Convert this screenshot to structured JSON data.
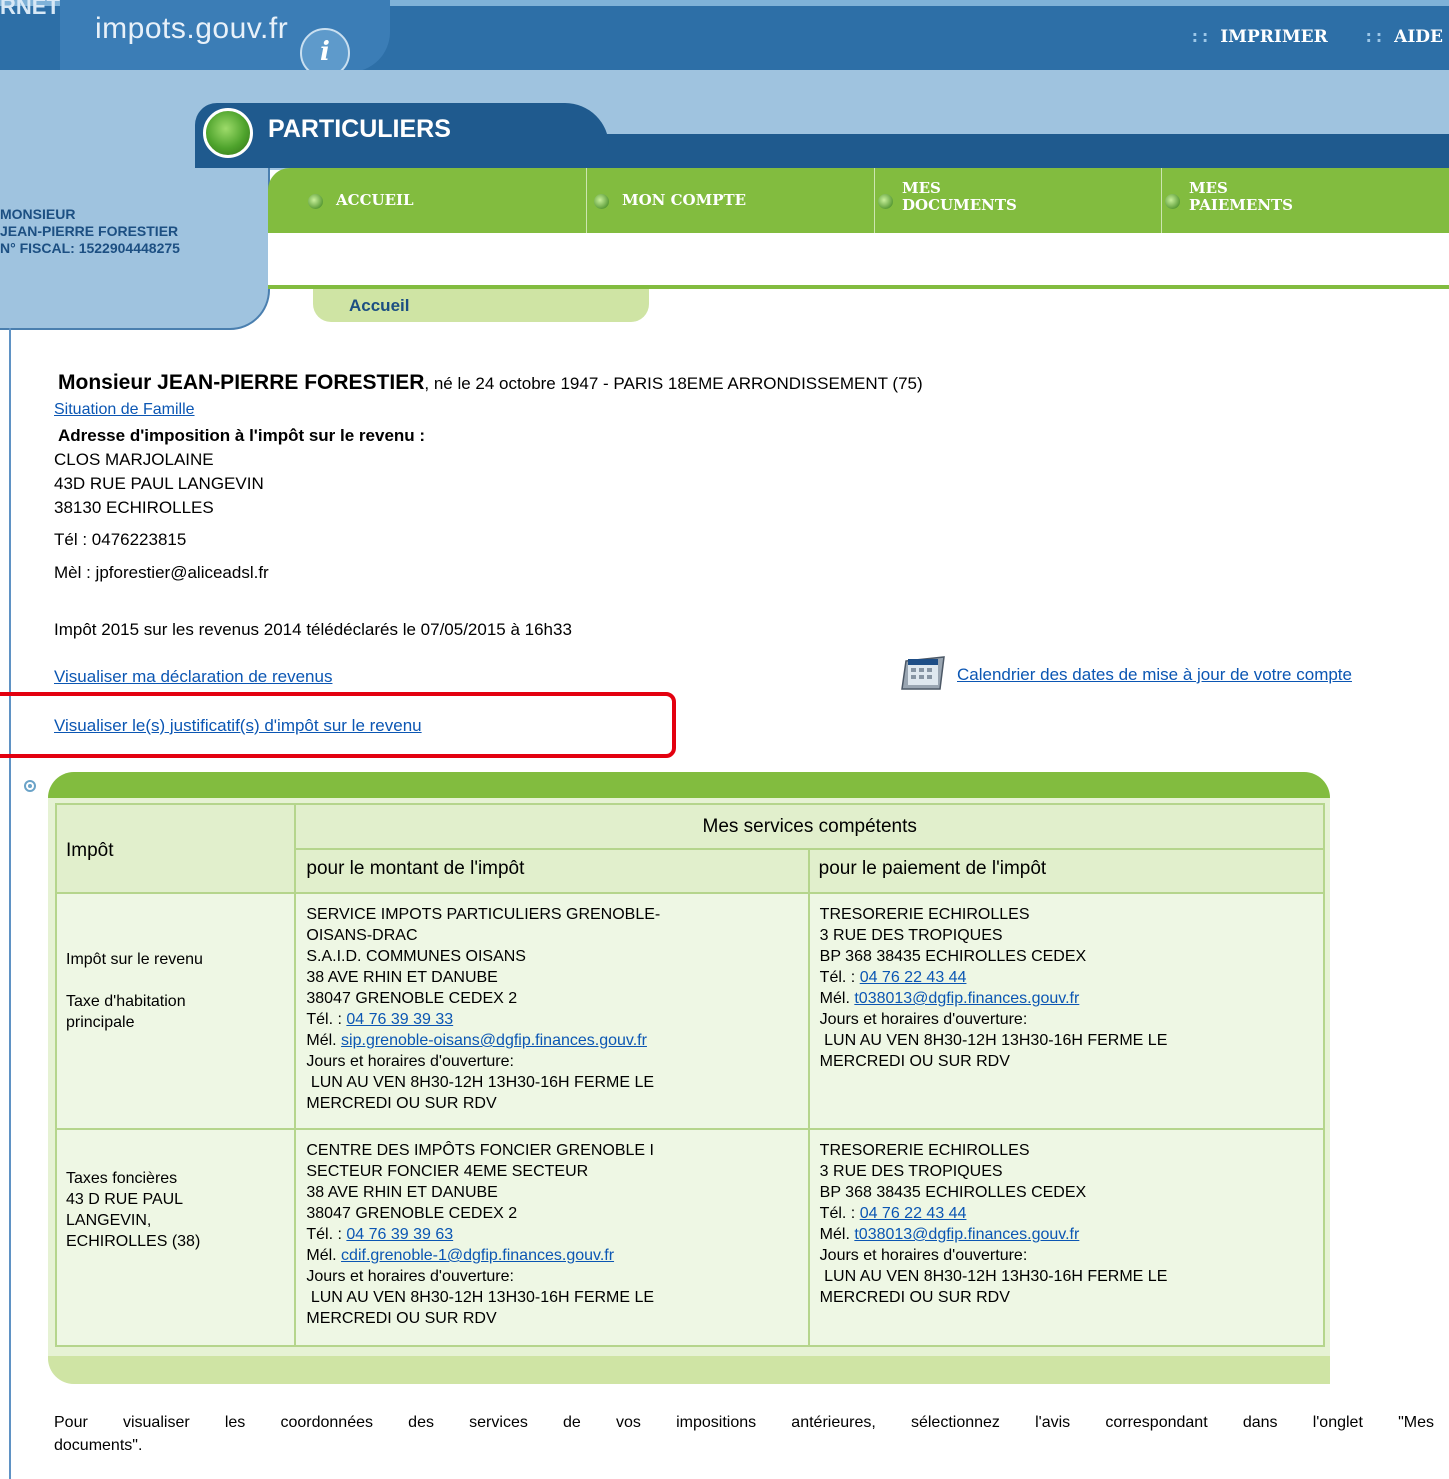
{
  "header": {
    "corner_text": "RNET",
    "logo_text": "impots.gouv.fr",
    "logo_badge": "i",
    "links": [
      "IMPRIMER",
      "AIDE"
    ],
    "section": "PARTICULIERS"
  },
  "user": {
    "civility": "MONSIEUR",
    "name": "JEAN-PIERRE FORESTIER",
    "fiscal": "N° FISCAL: 1522904448275"
  },
  "nav": {
    "items": [
      {
        "line1": "ACCUEIL",
        "line2": ""
      },
      {
        "line1": "MON COMPTE",
        "line2": ""
      },
      {
        "line1": "MES",
        "line2": "DOCUMENTS"
      },
      {
        "line1": "MES",
        "line2": "PAIEMENTS"
      }
    ],
    "subtab": "Accueil"
  },
  "info": {
    "name": "Monsieur JEAN-PIERRE FORESTIER",
    "birth": ", né le 24 octobre 1947  - PARIS 18EME ARRONDISSEMENT (75)",
    "family_link": "Situation de Famille",
    "address_title": "Adresse d'imposition à l'impôt sur le revenu :",
    "address": [
      "CLOS MARJOLAINE",
      "43D RUE PAUL LANGEVIN",
      "38130 ECHIROLLES"
    ],
    "tel": "Tél :  0476223815",
    "mail": "Mèl :  jpforestier@aliceadsl.fr",
    "declaration": "Impôt 2015 sur les revenus 2014 télédéclarés le 07/05/2015 à 16h33",
    "link_declaration": "Visualiser ma déclaration de revenus",
    "link_justif": "Visualiser le(s) justificatif(s) d'impôt sur le revenu",
    "link_calendar": "Calendrier des dates de mise à jour de votre compte"
  },
  "table": {
    "col_impot": "Impôt",
    "group_header": "Mes services compétents",
    "col_montant": "pour le montant de l'impôt",
    "col_paiement": "pour le paiement de l'impôt",
    "rows": [
      {
        "impot": [
          "Impôt sur le revenu",
          "",
          "Taxe d'habitation",
          "principale"
        ],
        "montant": {
          "lines": [
            "SERVICE IMPOTS PARTICULIERS GRENOBLE-",
            "OISANS-DRAC",
            "S.A.I.D. COMMUNES OISANS",
            "38 AVE RHIN ET DANUBE",
            "38047 GRENOBLE CEDEX 2"
          ],
          "tel_prefix": "Tél. : ",
          "tel": "04 76 39 39 33",
          "mail_prefix": "Mél. ",
          "mail": "sip.grenoble-oisans@dgfip.finances.gouv.fr",
          "hours_label": "Jours et horaires d'ouverture:",
          "hours": [
            " LUN AU VEN 8H30-12H 13H30-16H FERME LE",
            "MERCREDI OU SUR RDV"
          ]
        },
        "paiement": {
          "lines": [
            "TRESORERIE ECHIROLLES",
            "3 RUE DES TROPIQUES",
            "BP 368 38435 ECHIROLLES CEDEX"
          ],
          "tel_prefix": "Tél. : ",
          "tel": "04 76 22 43 44",
          "mail_prefix": "Mél. ",
          "mail": "t038013@dgfip.finances.gouv.fr",
          "hours_label": "Jours et horaires d'ouverture:",
          "hours": [
            " LUN AU VEN 8H30-12H 13H30-16H FERME LE",
            "MERCREDI OU SUR RDV"
          ]
        }
      },
      {
        "impot": [
          "Taxes foncières",
          "43 D RUE PAUL",
          "LANGEVIN,",
          "ECHIROLLES (38)"
        ],
        "montant": {
          "lines": [
            "CENTRE DES IMPÔTS FONCIER GRENOBLE I",
            "SECTEUR FONCIER 4EME SECTEUR",
            "38 AVE RHIN ET DANUBE",
            "38047 GRENOBLE CEDEX 2"
          ],
          "tel_prefix": "Tél. : ",
          "tel": "04 76 39 39 63",
          "mail_prefix": "Mél. ",
          "mail": "cdif.grenoble-1@dgfip.finances.gouv.fr",
          "hours_label": "Jours et horaires d'ouverture:",
          "hours": [
            " LUN AU VEN 8H30-12H 13H30-16H FERME LE",
            "MERCREDI OU SUR RDV"
          ]
        },
        "paiement": {
          "lines": [
            "TRESORERIE ECHIROLLES",
            "3 RUE DES TROPIQUES",
            "BP 368 38435 ECHIROLLES CEDEX"
          ],
          "tel_prefix": "Tél. : ",
          "tel": "04 76 22 43 44",
          "mail_prefix": "Mél. ",
          "mail": "t038013@dgfip.finances.gouv.fr",
          "hours_label": "Jours et horaires d'ouverture:",
          "hours": [
            " LUN AU VEN 8H30-12H 13H30-16H FERME LE",
            "MERCREDI OU SUR RDV"
          ]
        }
      }
    ]
  },
  "footer": {
    "line1": "Pour visualiser les coordonnées des services de vos impositions antérieures, sélectionnez l'avis correspondant dans l'onglet \"Mes",
    "line2": "documents\"."
  },
  "colors": {
    "brand_blue": "#2d6fa7",
    "nav_green": "#82bc3f",
    "highlight_red": "#e3000f"
  }
}
